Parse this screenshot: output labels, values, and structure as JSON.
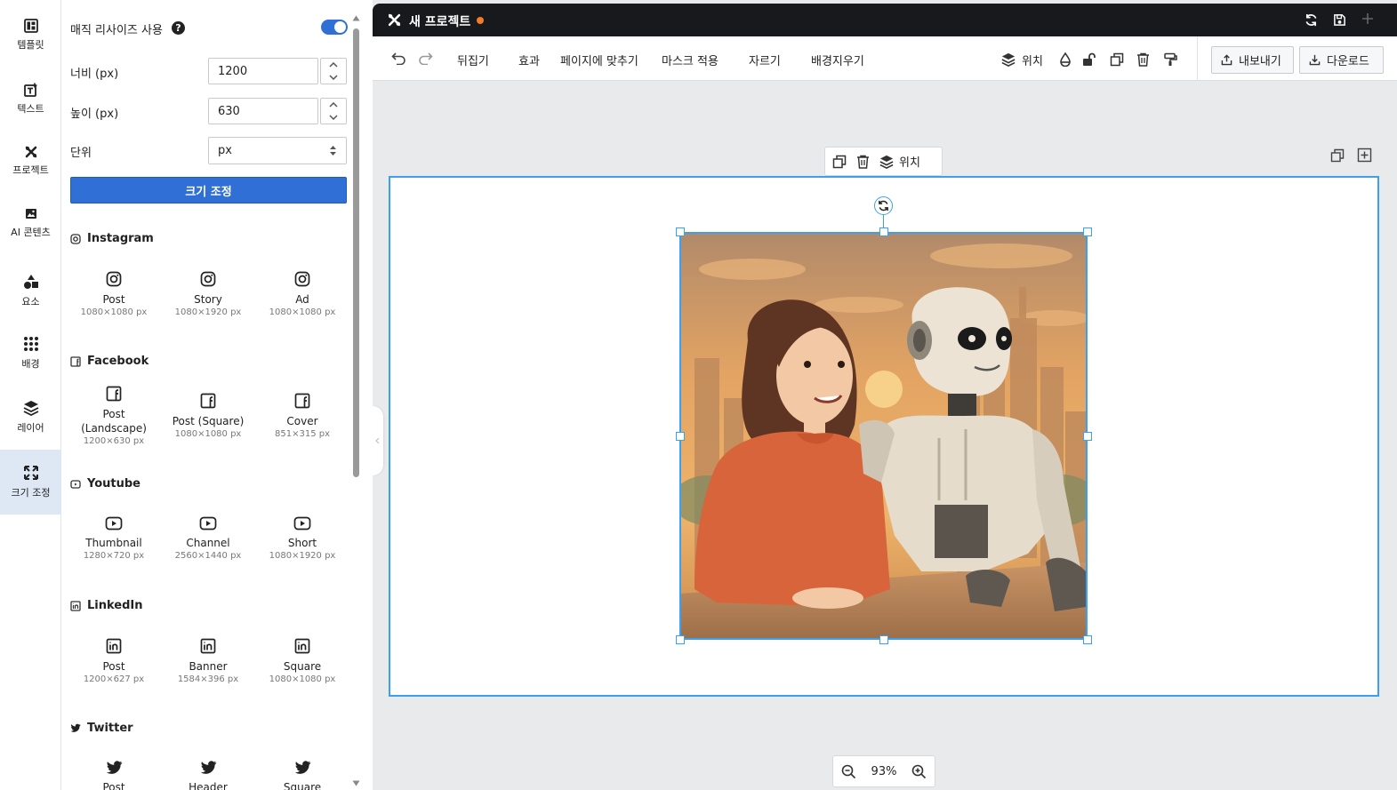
{
  "rail": {
    "items": [
      {
        "label": "템플릿",
        "icon": "template-icon"
      },
      {
        "label": "텍스트",
        "icon": "text-icon"
      },
      {
        "label": "프로젝트",
        "icon": "project-icon"
      },
      {
        "label": "AI 콘텐츠",
        "icon": "ai-content-icon"
      },
      {
        "label": "요소",
        "icon": "elements-icon"
      },
      {
        "label": "배경",
        "icon": "background-icon"
      },
      {
        "label": "레이어",
        "icon": "layers-icon"
      },
      {
        "label": "크기 조정",
        "icon": "resize-icon",
        "active": true
      }
    ]
  },
  "panel": {
    "magic_resize_label": "매직 리사이즈 사용",
    "magic_resize_on": true,
    "width_label": "너비 (px)",
    "width_value": "1200",
    "height_label": "높이 (px)",
    "height_value": "630",
    "unit_label": "단위",
    "unit_value": "px",
    "resize_button": "크기 조정",
    "sections": [
      {
        "title": "Instagram",
        "presets": [
          {
            "name": "Post",
            "size": "1080×1080 px"
          },
          {
            "name": "Story",
            "size": "1080×1920 px"
          },
          {
            "name": "Ad",
            "size": "1080×1080 px"
          }
        ]
      },
      {
        "title": "Facebook",
        "presets": [
          {
            "name": "Post (Landscape)",
            "size": "1200×630 px"
          },
          {
            "name": "Post (Square)",
            "size": "1080×1080 px"
          },
          {
            "name": "Cover",
            "size": "851×315 px"
          }
        ]
      },
      {
        "title": "Youtube",
        "presets": [
          {
            "name": "Thumbnail",
            "size": "1280×720 px"
          },
          {
            "name": "Channel",
            "size": "2560×1440 px"
          },
          {
            "name": "Short",
            "size": "1080×1920 px"
          }
        ]
      },
      {
        "title": "LinkedIn",
        "presets": [
          {
            "name": "Post",
            "size": "1200×627 px"
          },
          {
            "name": "Banner",
            "size": "1584×396 px"
          },
          {
            "name": "Square",
            "size": "1080×1080 px"
          }
        ]
      },
      {
        "title": "Twitter",
        "presets": [
          {
            "name": "Post",
            "size": ""
          },
          {
            "name": "Header",
            "size": ""
          },
          {
            "name": "Square",
            "size": ""
          }
        ]
      }
    ]
  },
  "topbar": {
    "project_title": "새 프로젝트",
    "unsaved_dot_color": "#f07c2c"
  },
  "toolbar": {
    "flip": "뒤집기",
    "effects": "효과",
    "fit_to_page": "페이지에 맞추기",
    "apply_mask": "마스크 적용",
    "crop": "자르기",
    "remove_bg": "배경지우기",
    "position": "위치",
    "export": "내보내기",
    "download": "다운로드"
  },
  "selection_bar": {
    "position": "위치"
  },
  "zoom": {
    "level": "93%"
  },
  "colors": {
    "accent": "#2f6fd6",
    "selection": "#3ba0f2",
    "topbar": "#17191c"
  }
}
